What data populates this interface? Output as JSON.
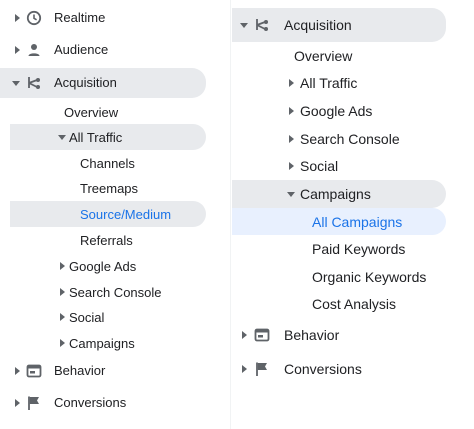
{
  "left": {
    "realtime": "Realtime",
    "audience": "Audience",
    "acquisition": "Acquisition",
    "overview": "Overview",
    "all_traffic": "All Traffic",
    "channels": "Channels",
    "treemaps": "Treemaps",
    "source_medium": "Source/Medium",
    "referrals": "Referrals",
    "google_ads": "Google Ads",
    "search_console": "Search Console",
    "social": "Social",
    "campaigns": "Campaigns",
    "behavior": "Behavior",
    "conversions": "Conversions"
  },
  "right": {
    "acquisition": "Acquisition",
    "overview": "Overview",
    "all_traffic": "All Traffic",
    "google_ads": "Google Ads",
    "search_console": "Search Console",
    "social": "Social",
    "campaigns": "Campaigns",
    "all_campaigns": "All Campaigns",
    "paid_keywords": "Paid Keywords",
    "organic_keywords": "Organic Keywords",
    "cost_analysis": "Cost Analysis",
    "behavior": "Behavior",
    "conversions": "Conversions"
  },
  "colors": {
    "accent": "#1a73e8",
    "selected_bg": "#e8eaed",
    "selected_blue_bg": "#e8f0fe",
    "icon": "#5f6368"
  }
}
